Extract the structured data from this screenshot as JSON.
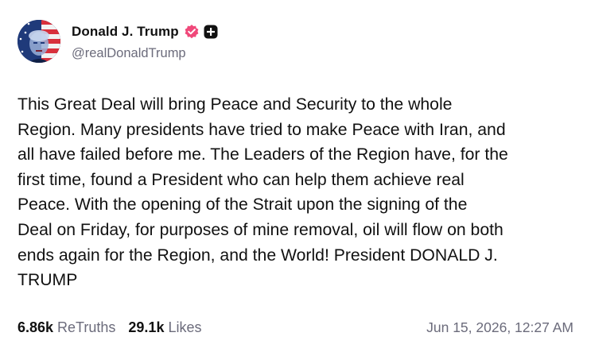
{
  "author": {
    "display_name": "Donald J. Trump",
    "handle": "@realDonaldTrump",
    "verified_icon": "verified-badge-icon",
    "plus_icon": "plus-square-icon",
    "verified_color": "#f0487a"
  },
  "post": {
    "text": "This Great Deal will bring Peace and Security to the whole\nRegion. Many presidents have tried to make Peace with Iran, and\nall have failed before me. The Leaders of the Region have, for the\nfirst time, found a President who can help them achieve real\nPeace. With the opening of the Strait upon the signing of the\nDeal on Friday, for purposes of mine removal, oil will flow on both\nends again for the Region, and the World! President DONALD J.\nTRUMP"
  },
  "stats": {
    "retruths_count": "6.86k",
    "retruths_label": "ReTruths",
    "likes_count": "29.1k",
    "likes_label": "Likes",
    "timestamp": "Jun 15, 2026, 12:27 AM"
  }
}
